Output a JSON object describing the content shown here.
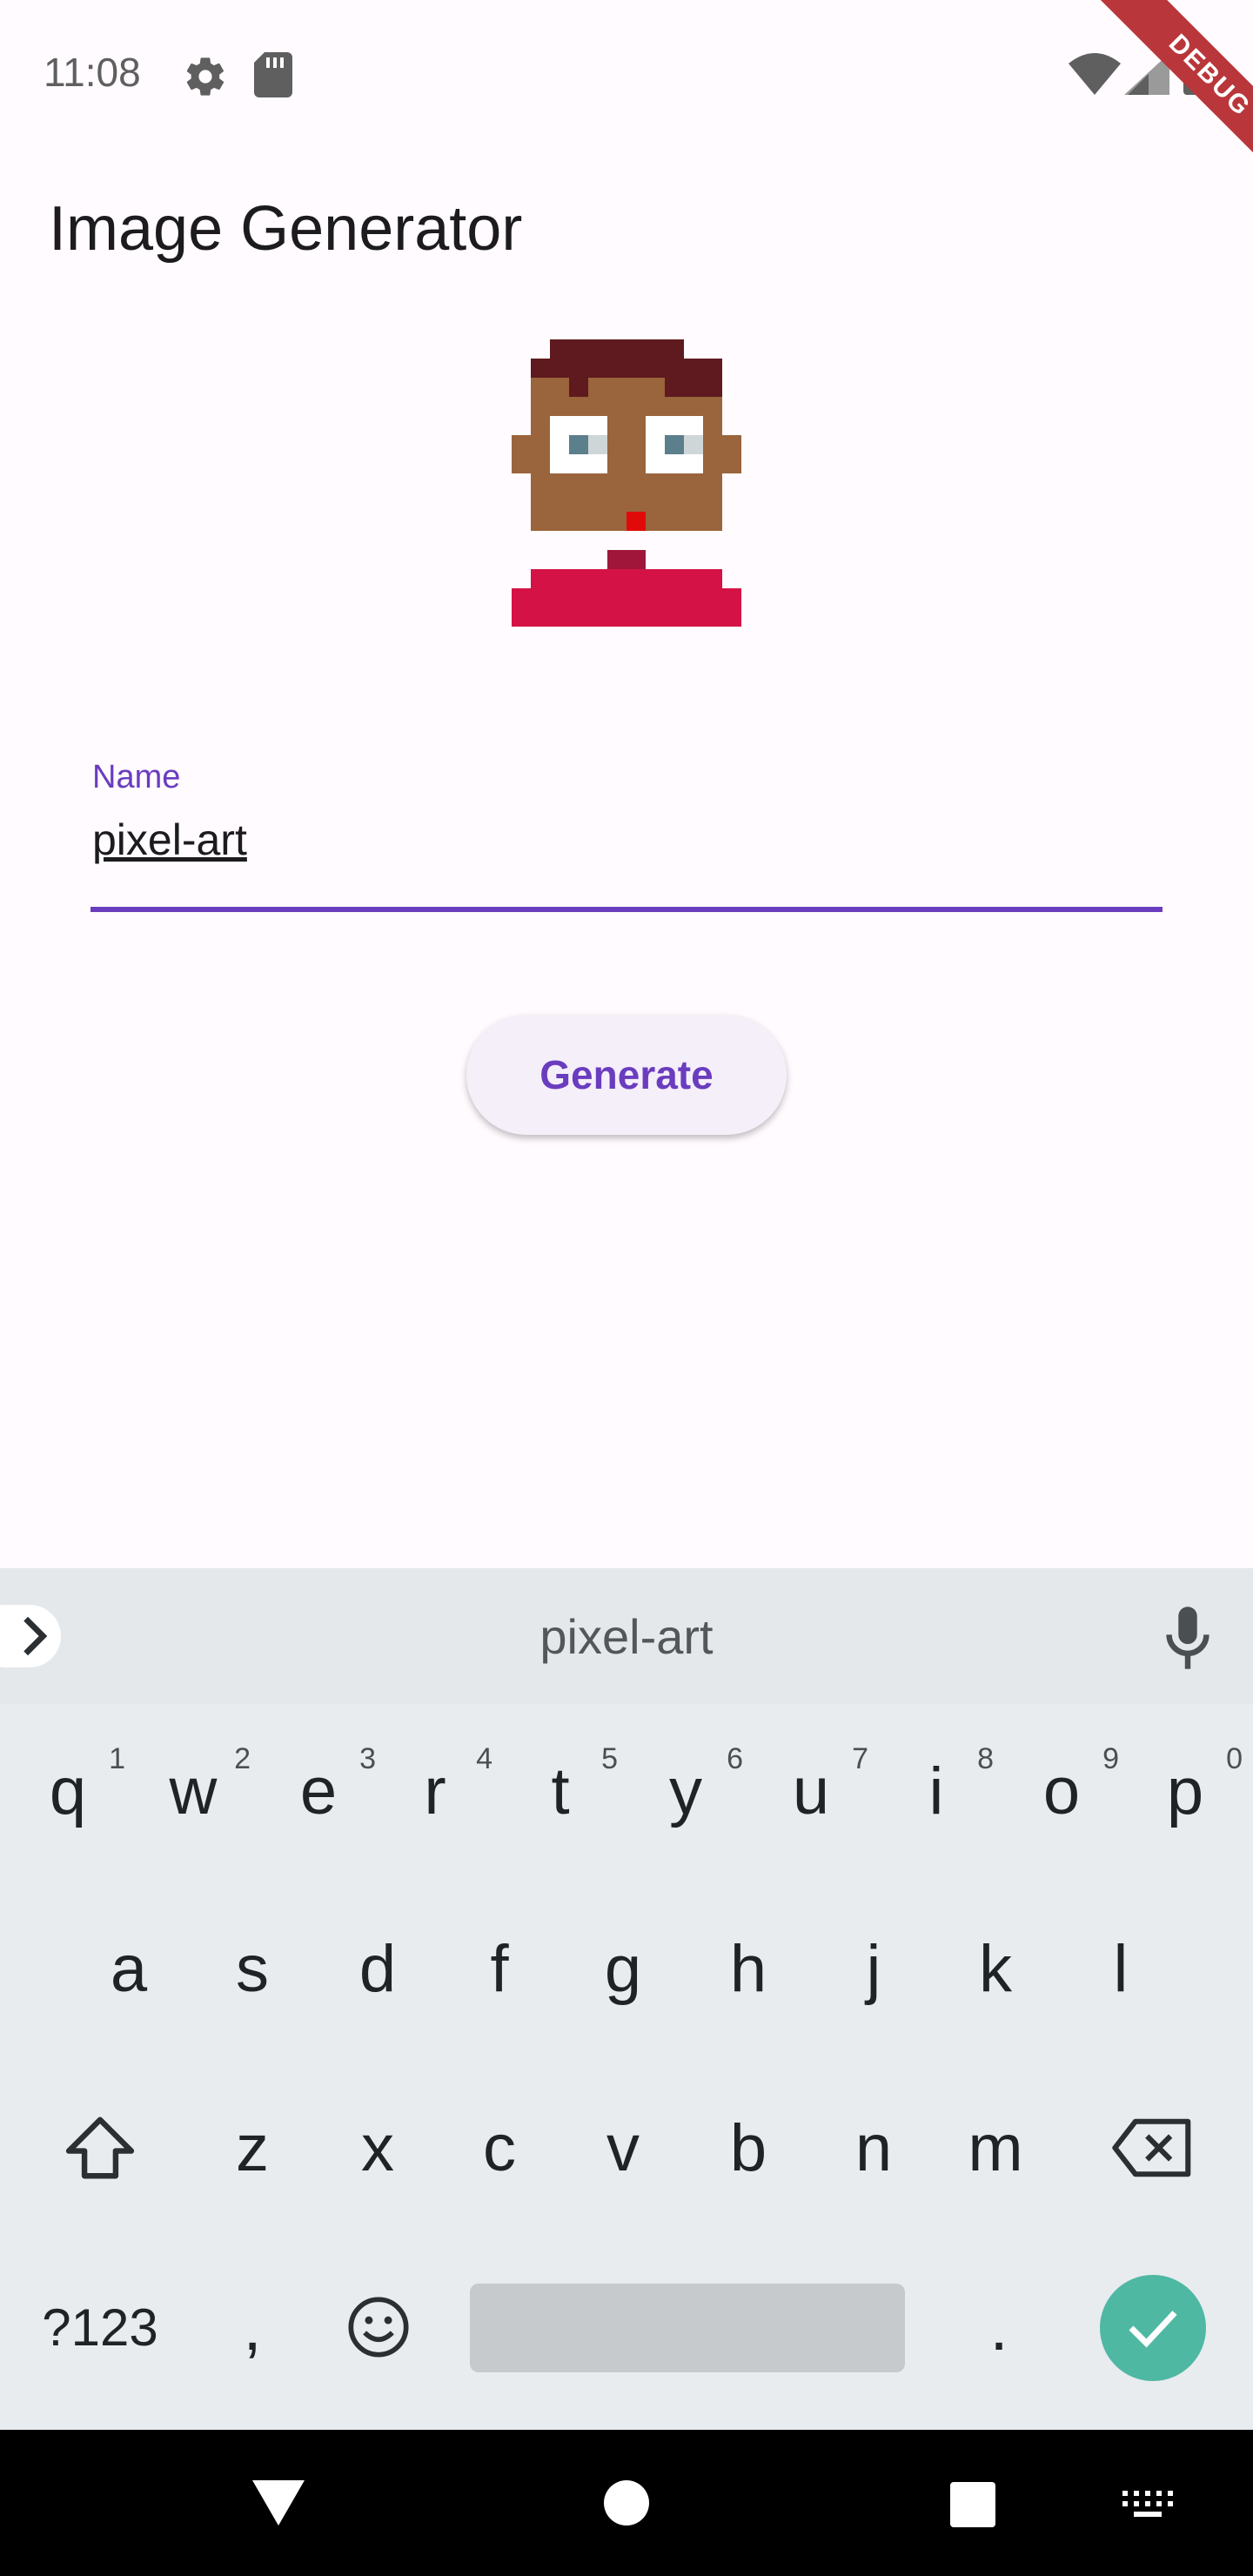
{
  "status_bar": {
    "time": "11:08",
    "icons": [
      "gear-icon",
      "sd-card-icon",
      "wifi-icon",
      "signal-icon",
      "battery-icon"
    ],
    "debug_banner": "DEBUG"
  },
  "app": {
    "title": "Image Generator",
    "avatar_icon": "pixel-avatar-icon",
    "name_field": {
      "label": "Name",
      "value": "pixel-art"
    },
    "generate_label": "Generate",
    "accent_color": "#6a3dbf"
  },
  "keyboard": {
    "suggestion": "pixel-art",
    "row1": [
      {
        "key": "q",
        "hint": "1"
      },
      {
        "key": "w",
        "hint": "2"
      },
      {
        "key": "e",
        "hint": "3"
      },
      {
        "key": "r",
        "hint": "4"
      },
      {
        "key": "t",
        "hint": "5"
      },
      {
        "key": "y",
        "hint": "6"
      },
      {
        "key": "u",
        "hint": "7"
      },
      {
        "key": "i",
        "hint": "8"
      },
      {
        "key": "o",
        "hint": "9"
      },
      {
        "key": "p",
        "hint": "0"
      }
    ],
    "row2": [
      "a",
      "s",
      "d",
      "f",
      "g",
      "h",
      "j",
      "k",
      "l"
    ],
    "row3": [
      "z",
      "x",
      "c",
      "v",
      "b",
      "n",
      "m"
    ],
    "symbols_label": "?123",
    "comma": ",",
    "period": ".",
    "icons": [
      "expand-icon",
      "mic-icon",
      "shift-icon",
      "backspace-icon",
      "emoji-icon",
      "enter-check-icon"
    ],
    "enter_color": "#4fb8a3"
  },
  "nav_bar": {
    "icons": [
      "back-icon",
      "home-icon",
      "recents-icon",
      "keyboard-switch-icon"
    ]
  }
}
